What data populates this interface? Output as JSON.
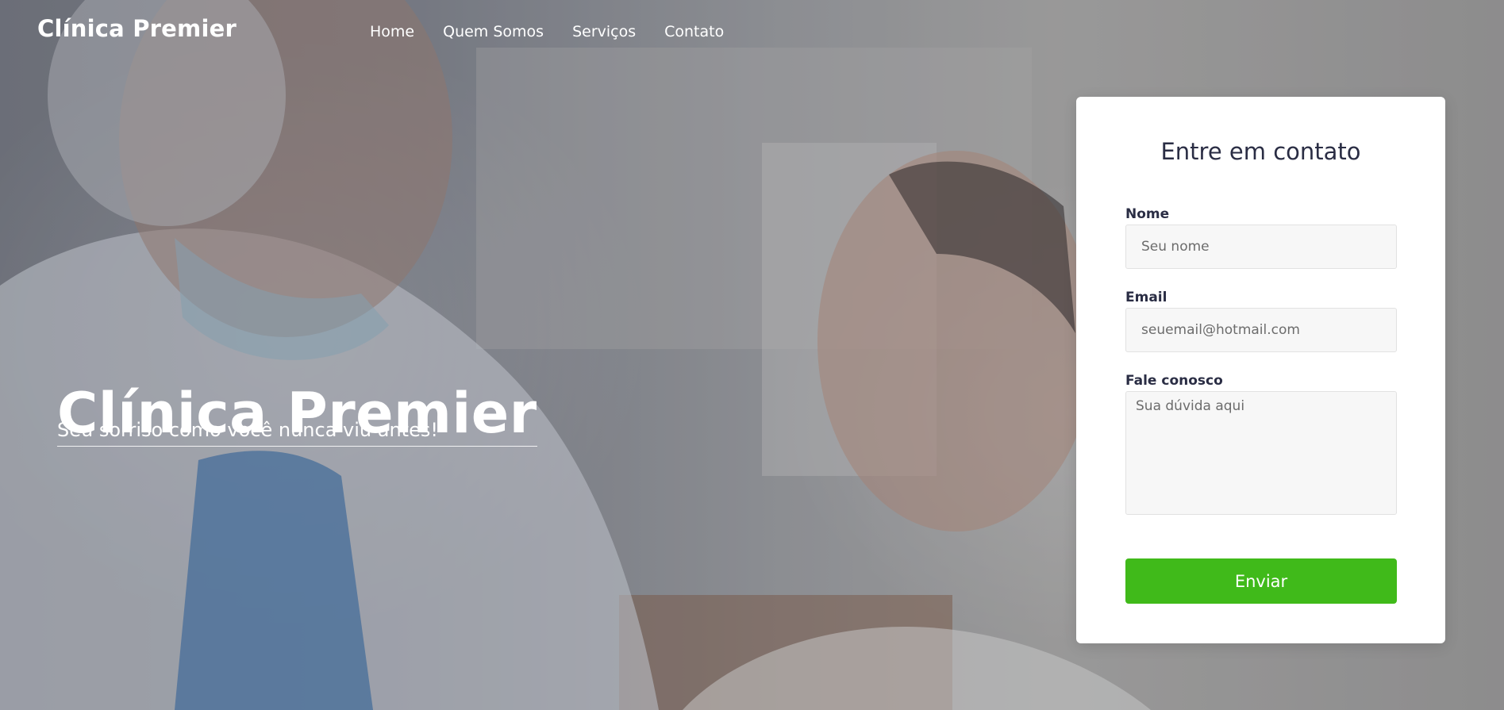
{
  "brand": {
    "name": "Clínica Premier"
  },
  "nav": {
    "items": [
      {
        "label": "Home"
      },
      {
        "label": "Quem Somos"
      },
      {
        "label": "Serviços"
      },
      {
        "label": "Contato"
      }
    ]
  },
  "hero": {
    "title": "Clínica Premier",
    "subtitle": "Seu sorriso como você nunca viu antes!"
  },
  "contact_form": {
    "title": "Entre em contato",
    "name_label": "Nome",
    "name_placeholder": "Seu nome",
    "email_label": "Email",
    "email_placeholder": "seuemail@hotmail.com",
    "message_label": "Fale conosco",
    "message_placeholder": "Sua dúvida aqui",
    "submit_label": "Enviar"
  },
  "colors": {
    "primary_button": "#40ba1a",
    "text_dark": "#2a2d44",
    "card_bg": "#ffffff"
  }
}
